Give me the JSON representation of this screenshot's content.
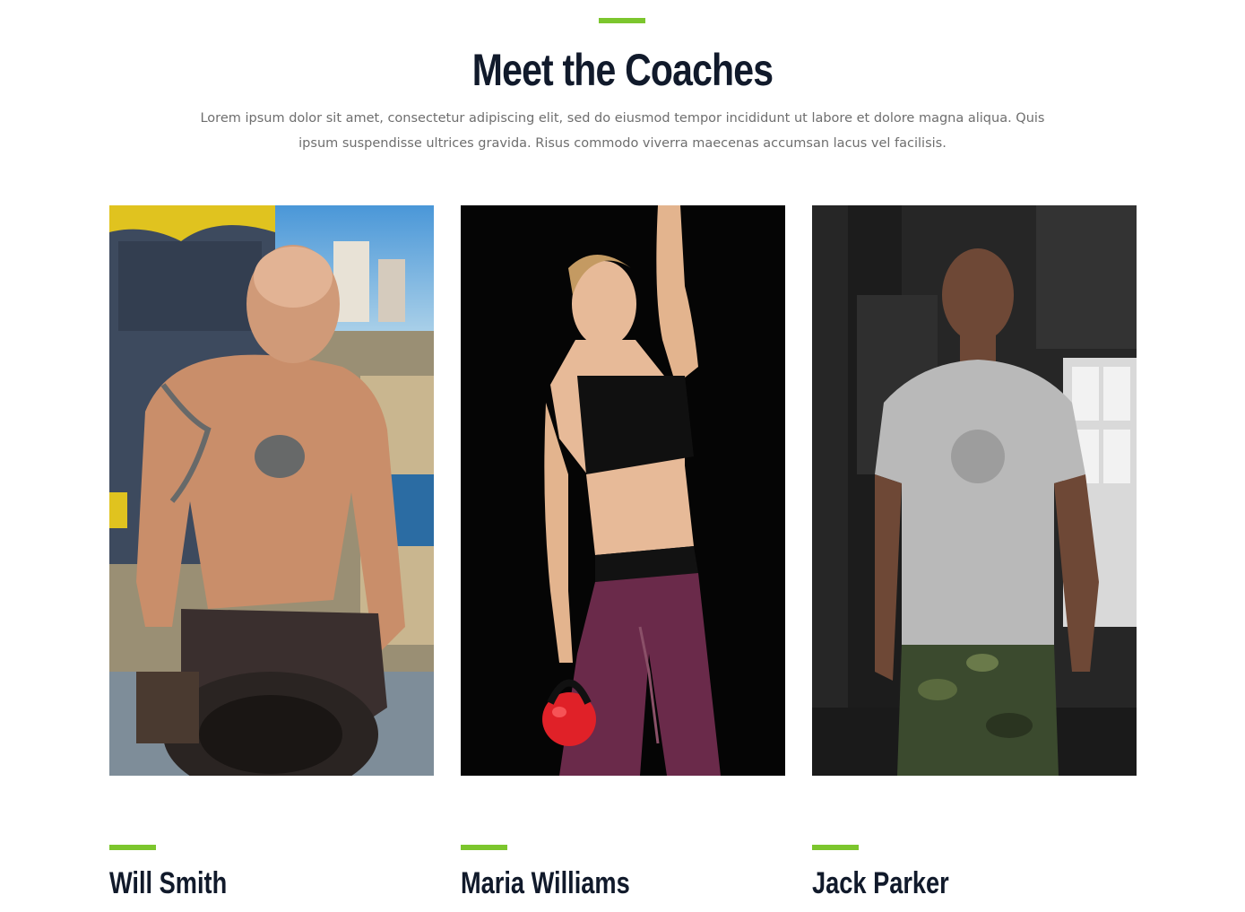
{
  "section": {
    "title": "Meet the Coaches",
    "description": "Lorem ipsum dolor sit amet, consectetur adipiscing elit, sed do eiusmod tempor incididunt ut labore et dolore magna aliqua. Quis ipsum suspendisse ultrices gravida. Risus commodo viverra maecenas accumsan lacus vel facilisis."
  },
  "colors": {
    "accent": "#7cc62d",
    "heading": "#111a2b",
    "body_text": "#6e6e6e"
  },
  "coaches": [
    {
      "name": "Will Smith"
    },
    {
      "name": "Maria Williams"
    },
    {
      "name": "Jack Parker"
    }
  ]
}
